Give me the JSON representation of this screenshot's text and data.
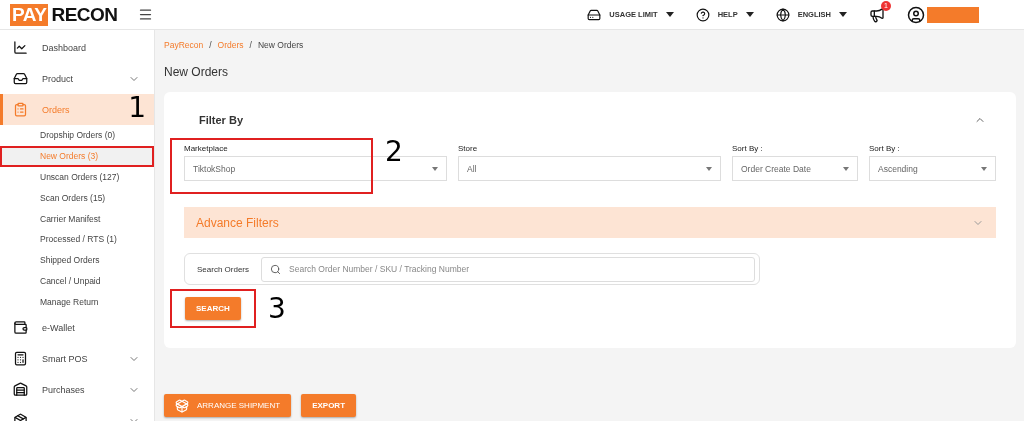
{
  "header": {
    "logo_left": "PAY",
    "logo_right": "RECON",
    "menus": [
      {
        "label": "USAGE LIMIT"
      },
      {
        "label": "HELP"
      },
      {
        "label": "ENGLISH"
      }
    ],
    "notification_count": "1"
  },
  "sidebar": {
    "items": [
      {
        "label": "Dashboard",
        "expandable": false,
        "selected": false
      },
      {
        "label": "Product",
        "expandable": true,
        "selected": false
      },
      {
        "label": "Orders",
        "expandable": false,
        "selected": true,
        "children": [
          {
            "label": "Dropship Orders (0)",
            "selected": false
          },
          {
            "label": "New Orders (3)",
            "selected": true,
            "boxed": true,
            "callout": "1"
          },
          {
            "label": "Unscan Orders (127)",
            "selected": false
          },
          {
            "label": "Scan Orders (15)",
            "selected": false
          },
          {
            "label": "Carrier Manifest",
            "selected": false
          },
          {
            "label": "Processed / RTS (1)",
            "selected": false
          },
          {
            "label": "Shipped Orders",
            "selected": false
          },
          {
            "label": "Cancel / Unpaid",
            "selected": false
          },
          {
            "label": "Manage Return",
            "selected": false
          }
        ]
      },
      {
        "label": "e-Wallet",
        "expandable": false,
        "selected": false
      },
      {
        "label": "Smart POS",
        "expandable": true,
        "selected": false
      },
      {
        "label": "Purchases",
        "expandable": true,
        "selected": false
      },
      {
        "expandable": true,
        "selected": false
      }
    ]
  },
  "breadcrumb": [
    "PayRecon",
    "/",
    "Orders",
    "/",
    "New Orders"
  ],
  "page_title": "New Orders",
  "filter": {
    "title": "Filter By",
    "expanded": true,
    "selects": [
      {
        "label": "Marketplace",
        "value": "TiktokShop",
        "boxed": true,
        "callout": "2"
      },
      {
        "label": "Store",
        "value": "All",
        "boxed": false
      },
      {
        "label": "Sort By :",
        "value": "Order Create Date",
        "boxed": false
      },
      {
        "label": "Sort By :",
        "value": "Ascending",
        "boxed": false
      }
    ],
    "advance_filters": {
      "label": "Advance Filters",
      "expanded": false
    },
    "search_label": "Search Orders",
    "search": {
      "placeholder": "Search Order Number / SKU / Tracking Number"
    },
    "search_button": {
      "label": "SEARCH",
      "boxed": true,
      "callout": "3"
    }
  },
  "actions": [
    "ARRANGE SHIPMENT",
    "EXPORT"
  ]
}
